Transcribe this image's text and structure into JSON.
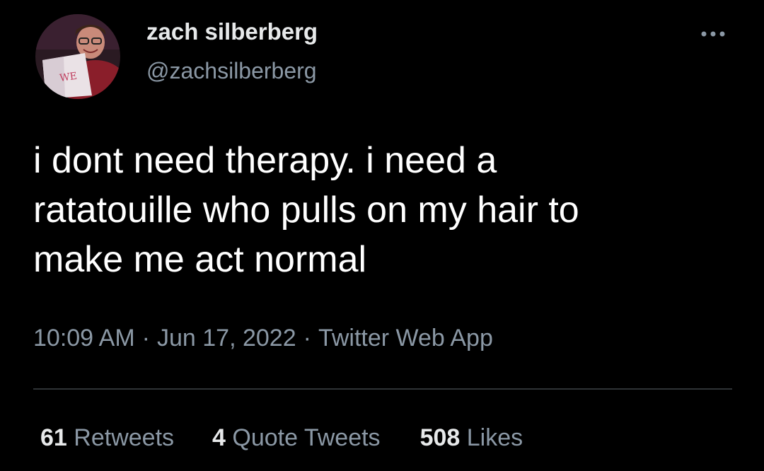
{
  "author": {
    "display_name": "zach silberberg",
    "handle": "@zachsilberberg",
    "avatar_icon": "profile-photo"
  },
  "tweet": {
    "lines": [
      "i dont need therapy. i need a",
      "ratatouille who pulls on my hair to",
      "make me act normal"
    ]
  },
  "meta": {
    "time": "10:09 AM",
    "separator": "·",
    "date": "Jun 17, 2022",
    "source": "Twitter Web App"
  },
  "stats": {
    "retweets_count": "61",
    "retweets_label": "Retweets",
    "quotes_count": "4",
    "quotes_label": "Quote Tweets",
    "likes_count": "508",
    "likes_label": "Likes"
  },
  "colors": {
    "background": "#000000",
    "primary_text": "#e7e9ea",
    "secondary_text": "#8b98a5",
    "divider": "#2f3336"
  }
}
